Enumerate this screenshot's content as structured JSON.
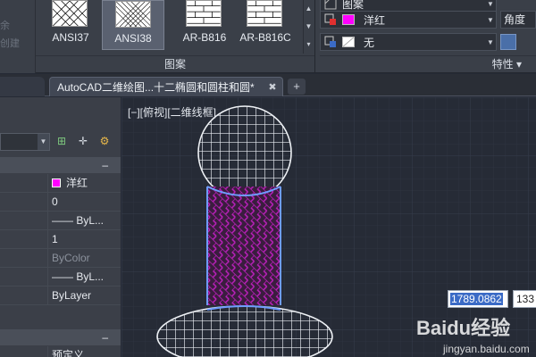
{
  "ribbon": {
    "left_labels": [
      "余",
      "创建"
    ],
    "patterns": [
      {
        "label": "ANSI37",
        "type": "cross",
        "active": false
      },
      {
        "label": "ANSI38",
        "type": "dense",
        "active": true
      },
      {
        "label": "AR-B816",
        "type": "brick",
        "active": false
      },
      {
        "label": "AR-B816C",
        "type": "brick",
        "active": false
      }
    ],
    "pattern_group_label": "图案",
    "properties_group_label": "特性 ▾",
    "top_row_text": "图案",
    "color_row": {
      "text": "洋红",
      "swatch": "#ff00ff"
    },
    "bg_row": {
      "text": "无"
    },
    "angle_label": "角度"
  },
  "tabs": {
    "active_title": "AutoCAD二维绘图...十二椭圆和圆柱和圆*",
    "close_glyph": "✖",
    "add_glyph": "+"
  },
  "palette": {
    "tools": [
      "⊞",
      "✛",
      "⚙"
    ],
    "section_toggle": "–",
    "rows": [
      {
        "value": "洋红",
        "chip": "#ff00ff",
        "dim": false
      },
      {
        "value": "0",
        "dim": false
      },
      {
        "value": "—— ByL...",
        "dim": false
      },
      {
        "value": "1",
        "dim": false
      },
      {
        "value": "ByColor",
        "dim": true
      },
      {
        "value": "—— ByL...",
        "dim": false
      },
      {
        "value": "ByLayer",
        "dim": false
      }
    ],
    "bottom_value": "预定义"
  },
  "viewport": {
    "label": "[−][俯视][二维线框]",
    "coord_value": "1789.0862",
    "coord_value2": "133"
  },
  "watermark": {
    "text": "Baidu经验",
    "url": "jingyan.baidu.com"
  },
  "colors": {
    "hatch_magenta": "#c000c0",
    "selection_blue": "#5a8dff"
  }
}
